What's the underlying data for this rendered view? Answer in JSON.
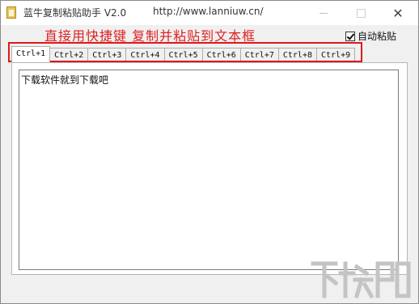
{
  "window": {
    "title": "蓝牛复制粘贴助手 V2.0",
    "url": "http://www.lanniuw.cn/",
    "close_glyph": "✕"
  },
  "header": {
    "slogan": "直接用快捷键 复制并粘贴到文本框",
    "auto_paste_label": "自动粘贴",
    "auto_paste_checked": true
  },
  "tabs": [
    {
      "label": "Ctrl+1",
      "active": true
    },
    {
      "label": "Ctrl+2",
      "active": false
    },
    {
      "label": "Ctrl+3",
      "active": false
    },
    {
      "label": "Ctrl+4",
      "active": false
    },
    {
      "label": "Ctrl+5",
      "active": false
    },
    {
      "label": "Ctrl+6",
      "active": false
    },
    {
      "label": "Ctrl+7",
      "active": false
    },
    {
      "label": "Ctrl+8",
      "active": false
    },
    {
      "label": "Ctrl+9",
      "active": false
    }
  ],
  "editor": {
    "content": "下载软件就到下载吧"
  },
  "colors": {
    "accent_red": "#e02020",
    "highlight_box": "#e01818",
    "window_bg": "#f0f0f0"
  },
  "watermark": {
    "icon": "xiazaiba-logo-watermark"
  }
}
